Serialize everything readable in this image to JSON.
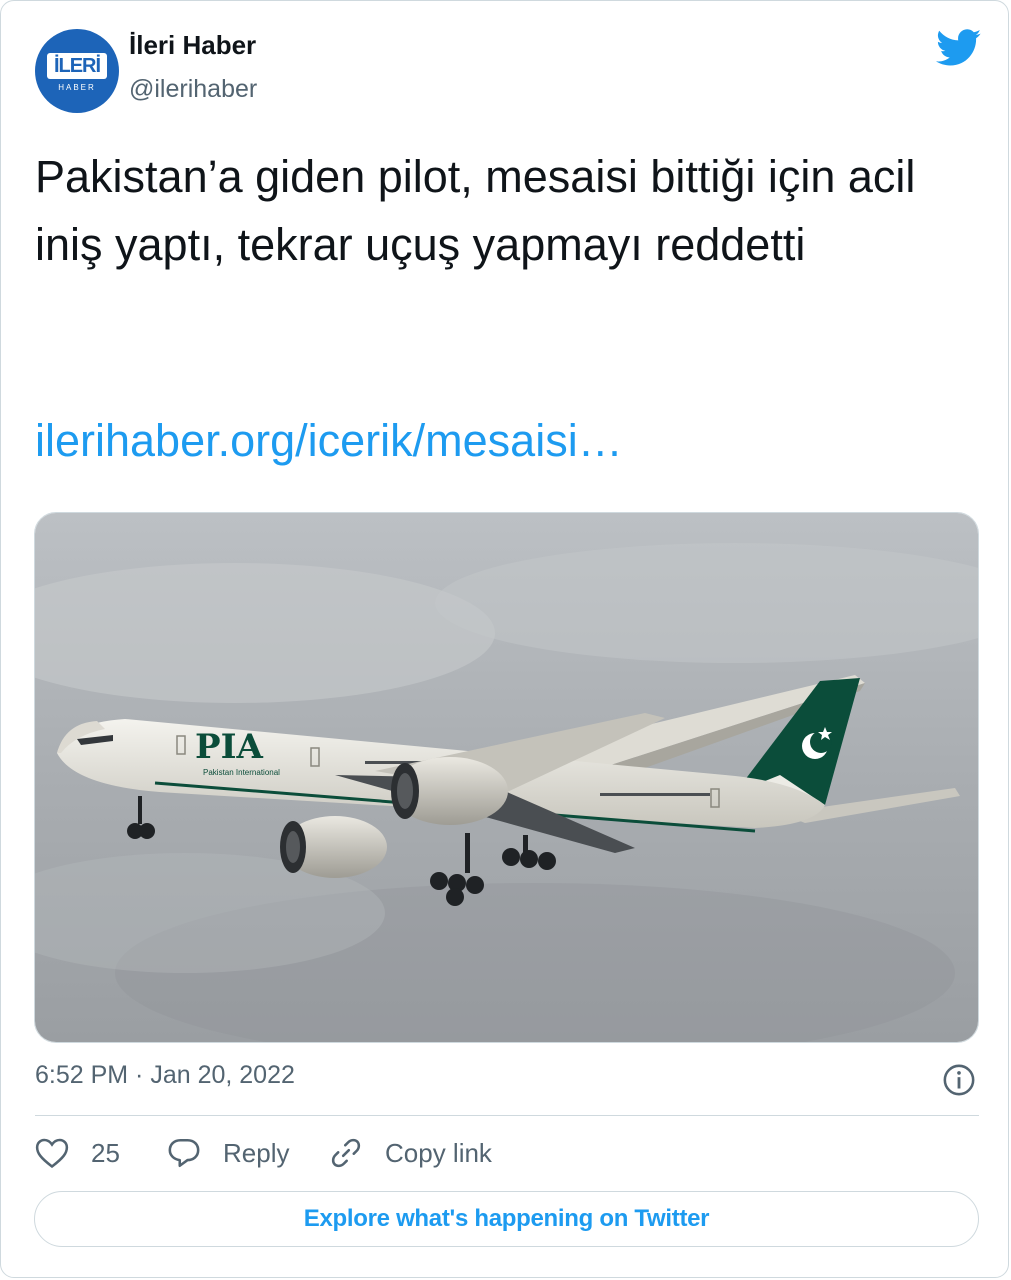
{
  "author": {
    "name": "İleri Haber",
    "handle": "@ilerihaber",
    "avatar_text": "İLERİ",
    "avatar_subtext": "HABER"
  },
  "tweet": {
    "text": "Pakistan’a giden pilot, mesaisi bittiği için acil iniş yaptı, tekrar uçuş yapmayı reddetti",
    "link": "ilerihaber.org/icerik/mesaisi…",
    "timestamp": "6:52 PM · Jan 20, 2022"
  },
  "media": {
    "description_icon": "photo-icon",
    "aircraft_livery_text": "PIA",
    "aircraft_subtext": "Pakistan International"
  },
  "actions": {
    "like_count": "25",
    "reply_label": "Reply",
    "copy_link_label": "Copy link"
  },
  "footer": {
    "explore_label": "Explore what's happening on Twitter"
  },
  "colors": {
    "accent": "#1d9bf0",
    "secondary_text": "#536471",
    "border": "#cfd9de",
    "livery_green": "#0b4d3a"
  }
}
